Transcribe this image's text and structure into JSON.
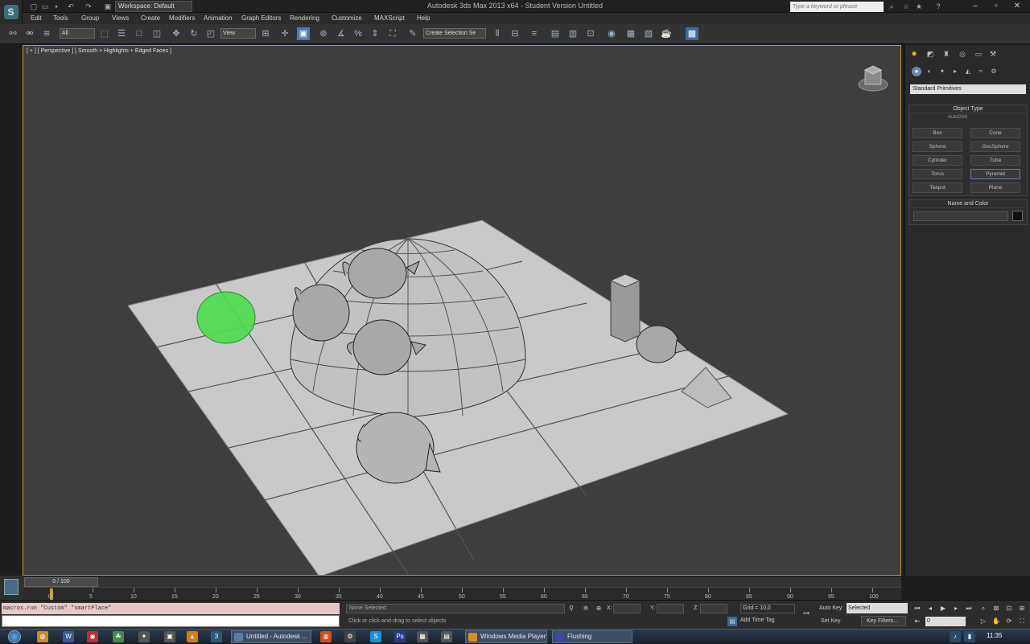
{
  "window": {
    "title": "Autodesk 3ds Max  2013 x64  -  Student Version   Untitled",
    "workspace": "Workspace: Default",
    "search_placeholder": "Type a keyword or phrase"
  },
  "menu": [
    "Edit",
    "Tools",
    "Group",
    "Views",
    "Create",
    "Modifiers",
    "Animation",
    "Graph Editors",
    "Rendering",
    "Customize",
    "MAXScript",
    "Help"
  ],
  "toolbar": {
    "selection_filter": "All",
    "ref_coord": "View",
    "named_sel": "Create Selection Se"
  },
  "viewport": {
    "label": "[ + ] [ Perspective ] [ Smooth + Highlights + Edged Faces ]"
  },
  "command_panel": {
    "category": "Standard Primitives",
    "object_type_title": "Object Type",
    "autogrid": "AutoGrid",
    "buttons": [
      "Box",
      "Cone",
      "Sphere",
      "GeoSphere",
      "Cylinder",
      "Tube",
      "Torus",
      "Pyramid",
      "Teapot",
      "Plane"
    ],
    "name_color_title": "Name and Color"
  },
  "timeline": {
    "slider": "0 / 100",
    "ticks": [
      "0",
      "5",
      "10",
      "15",
      "20",
      "25",
      "30",
      "35",
      "40",
      "45",
      "50",
      "55",
      "60",
      "65",
      "70",
      "75",
      "80",
      "85",
      "90",
      "95",
      "100"
    ]
  },
  "status": {
    "script_line": "macros.run \"Custom\" \"smartPlace\"",
    "msg1": "None Selected",
    "msg2": "Click or click-and-drag to select objects",
    "x_lbl": "X:",
    "y_lbl": "Y:",
    "z_lbl": "Z:",
    "grid": "Grid = 10,0",
    "add_time_tag": "Add Time Tag",
    "auto_key": "Auto Key",
    "set_key": "Set Key",
    "selected": "Selected",
    "key_filters": "Key Filters...",
    "frame": "0"
  },
  "taskbar": {
    "items": [
      {
        "label": "Untitled - Autodesk ...",
        "color": "#5a7aa8"
      },
      {
        "label": "Windows Media Player",
        "color": "#e08a20"
      },
      {
        "label": "Flushing",
        "color": "#3a4aa8"
      }
    ],
    "clock": "11:35"
  }
}
